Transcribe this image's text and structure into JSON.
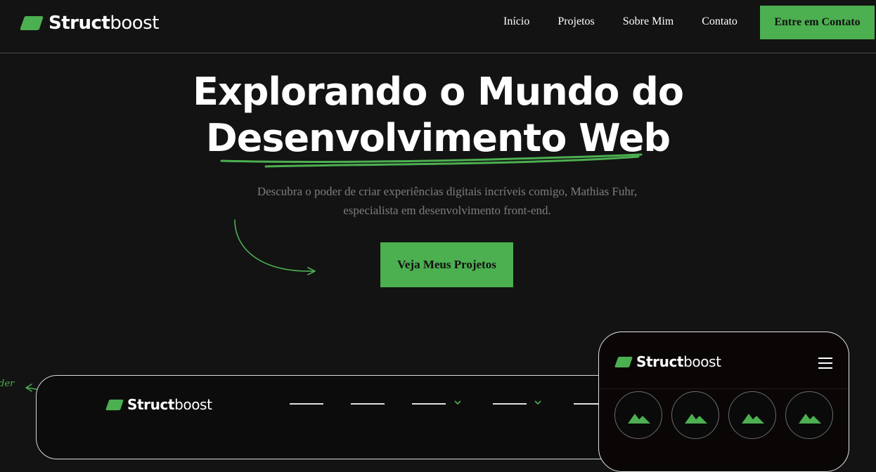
{
  "brand": {
    "name_bold": "Struct",
    "name_regular": "boost",
    "accent": "#4caf50"
  },
  "nav": {
    "items": [
      "Início",
      "Projetos",
      "Sobre Mim",
      "Contato"
    ],
    "cta": "Entre em Contato"
  },
  "hero": {
    "title_line1": "Explorando o Mundo do",
    "title_line2": "Desenvolvimento Web",
    "subtitle": "Descubra o poder de criar experiências digitais incríveis comigo, Mathias Fuhr, especialista em desenvolvimento front-end.",
    "cta": "Veja Meus Projetos"
  },
  "preview": {
    "side_note": "der"
  },
  "icons": {
    "logo": "logo-mark-icon",
    "arrow": "curved-arrow-icon",
    "menu": "hamburger-menu-icon",
    "chevron": "chevron-down-icon",
    "image": "mountain-image-icon"
  }
}
